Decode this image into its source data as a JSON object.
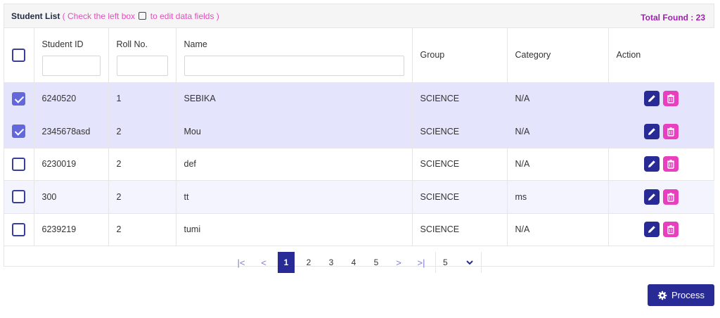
{
  "header": {
    "title": "Student List",
    "hint_prefix": "( Check the left box",
    "hint_suffix": "to edit data fields )",
    "total_found": "Total Found : 23"
  },
  "columns": {
    "student_id": "Student ID",
    "roll_no": "Roll No.",
    "name": "Name",
    "group": "Group",
    "category": "Category",
    "action": "Action"
  },
  "rows": [
    {
      "checked": true,
      "student_id": "6240520",
      "roll_no": "1",
      "name": "SEBIKA",
      "group": "SCIENCE",
      "category": "N/A"
    },
    {
      "checked": true,
      "student_id": "2345678asd",
      "roll_no": "2",
      "name": "Mou",
      "group": "SCIENCE",
      "category": "N/A"
    },
    {
      "checked": false,
      "student_id": "6230019",
      "roll_no": "2",
      "name": "def",
      "group": "SCIENCE",
      "category": "N/A"
    },
    {
      "checked": false,
      "student_id": "300",
      "roll_no": "2",
      "name": "tt",
      "group": "SCIENCE",
      "category": "ms"
    },
    {
      "checked": false,
      "student_id": "6239219",
      "roll_no": "2",
      "name": "tumi",
      "group": "SCIENCE",
      "category": "N/A"
    }
  ],
  "pagination": {
    "first": "|<",
    "prev": "<",
    "pages": [
      "1",
      "2",
      "3",
      "4",
      "5"
    ],
    "active_page": "1",
    "next": ">",
    "last": ">|",
    "page_size": "5"
  },
  "process_label": "Process",
  "colors": {
    "primary": "#282a96",
    "delete": "#e83fbf",
    "selected_row": "#e4e4fc",
    "hint": "#e64bbf",
    "total": "#a020b0"
  },
  "icons": {
    "edit": "pencil-icon",
    "delete": "trash-icon",
    "process": "gear-icon",
    "page_size": "chevron-down-icon"
  }
}
